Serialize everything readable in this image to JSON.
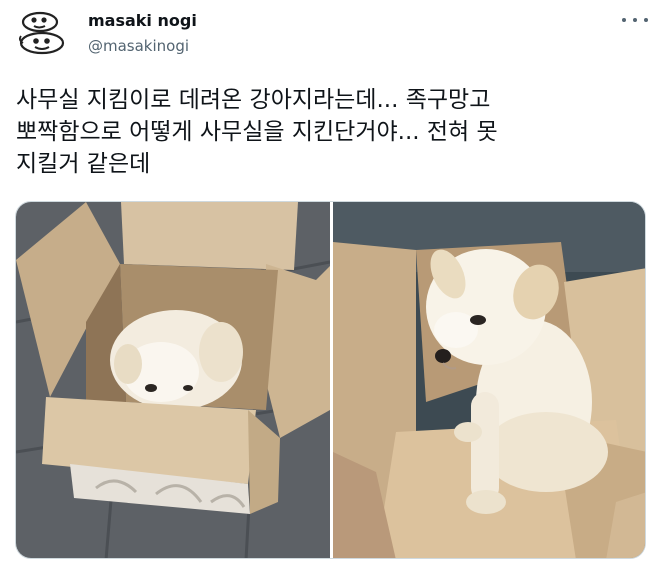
{
  "author": {
    "display_name": "masaki nogi",
    "handle": "@masakinogi"
  },
  "tweet": {
    "text_lines": [
      "사무실 지킴이로 데려온 강아지라는데... 족구망고",
      "뽀짝함으로 어떻게 사무실을 지킨단거야... 전혀 못",
      "지킬거 같은데"
    ]
  },
  "icons": {
    "more": "more-horizontal-icon",
    "avatar": "doodle-faces-avatar"
  },
  "colors": {
    "text": "#0f1419",
    "secondary": "#536471",
    "border": "#cfd9de"
  }
}
